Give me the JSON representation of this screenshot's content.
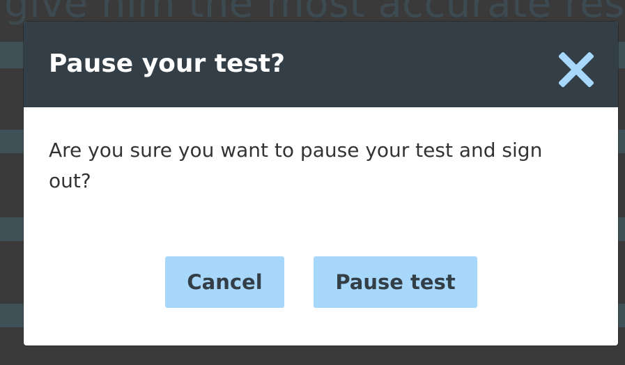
{
  "background": {
    "text": "give him the most accurate result"
  },
  "dialog": {
    "title": "Pause your test?",
    "close_icon": "close-icon",
    "message": "Are you sure you want to pause your test and sign out?",
    "buttons": {
      "cancel_label": "Cancel",
      "pause_label": "Pause test"
    }
  },
  "colors": {
    "header_bg": "#333e47",
    "button_bg": "#a7d8fb",
    "close_icon": "#a7d8fb",
    "overlay_dark": "#3a3a3a",
    "overlay_band": "#3f5057"
  }
}
